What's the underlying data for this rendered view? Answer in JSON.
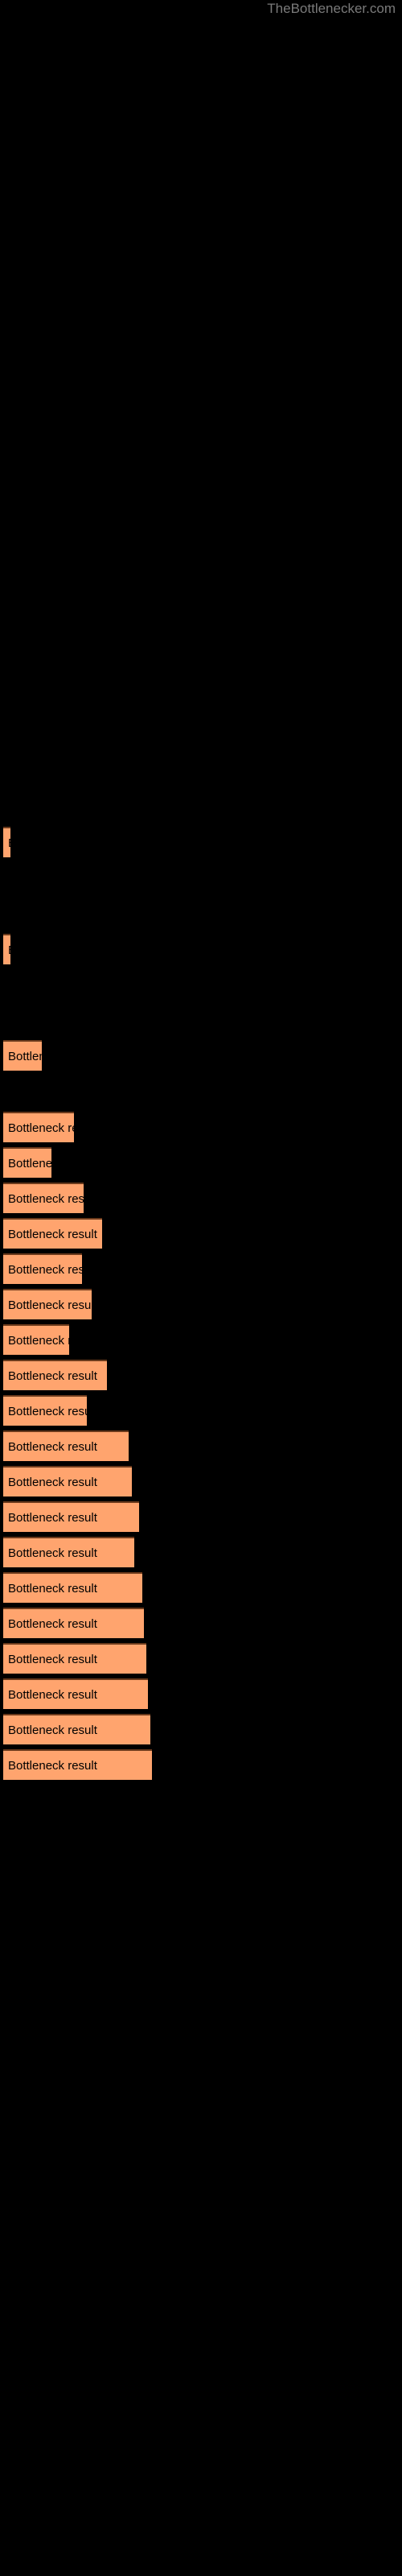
{
  "watermark": "TheBottlenecker.com",
  "colors": {
    "background": "#000000",
    "bar_fill": "#ffa46e",
    "bar_edge": "#6b3a1c",
    "bar_text": "#000000",
    "watermark_text": "#7a7a7a"
  },
  "chart_data": {
    "type": "bar",
    "orientation": "horizontal",
    "title": "",
    "subtitle": "",
    "xlabel": "",
    "ylabel": "",
    "grid": false,
    "legend": null,
    "axis_visible": false,
    "tick_labels_visible": false,
    "bar_label_text": "Bottleneck result",
    "categories": [
      "Bottleneck result",
      "Bottleneck result",
      "Bottleneck result",
      "Bottleneck result",
      "Bottleneck result",
      "Bottleneck result",
      "Bottleneck result",
      "Bottleneck result",
      "Bottleneck result",
      "Bottleneck result",
      "Bottleneck result",
      "Bottleneck result",
      "Bottleneck result",
      "Bottleneck result",
      "Bottleneck result",
      "Bottleneck result",
      "Bottleneck result",
      "Bottleneck result",
      "Bottleneck result",
      "Bottleneck result",
      "Bottleneck result",
      "Bottleneck result"
    ],
    "values": [
      9,
      9,
      25,
      45,
      27,
      57,
      72,
      46,
      67,
      38,
      83,
      50,
      101,
      105,
      118,
      110,
      130,
      133,
      146,
      148,
      157,
      160
    ],
    "xlim": [
      0,
      500
    ],
    "bar_tops": [
      1027,
      1203,
      1291,
      1335,
      1379,
      1423,
      1467,
      1511,
      1555,
      1599,
      1643,
      1687,
      1731,
      1775,
      1819,
      1863,
      1907,
      1951,
      1995,
      2039,
      2083,
      2127
    ]
  },
  "bars": [
    {
      "width": 9,
      "top": 1027,
      "label": "Bottleneck result"
    },
    {
      "width": 9,
      "top": 1160,
      "label": "Bottleneck result"
    },
    {
      "width": 48,
      "top": 1292,
      "label": "Bottleneck result"
    },
    {
      "width": 88,
      "top": 1381,
      "label": "Bottleneck result"
    },
    {
      "width": 60,
      "top": 1425,
      "label": "Bottleneck result"
    },
    {
      "width": 100,
      "top": 1469,
      "label": "Bottleneck result"
    },
    {
      "width": 123,
      "top": 1513,
      "label": "Bottleneck result"
    },
    {
      "width": 98,
      "top": 1557,
      "label": "Bottleneck result"
    },
    {
      "width": 110,
      "top": 1601,
      "label": "Bottleneck result"
    },
    {
      "width": 82,
      "top": 1645,
      "label": "Bottleneck result"
    },
    {
      "width": 129,
      "top": 1689,
      "label": "Bottleneck result"
    },
    {
      "width": 104,
      "top": 1733,
      "label": "Bottleneck result"
    },
    {
      "width": 156,
      "top": 1777,
      "label": "Bottleneck result"
    },
    {
      "width": 160,
      "top": 1821,
      "label": "Bottleneck result"
    },
    {
      "width": 169,
      "top": 1865,
      "label": "Bottleneck result"
    },
    {
      "width": 163,
      "top": 1909,
      "label": "Bottleneck result"
    },
    {
      "width": 173,
      "top": 1953,
      "label": "Bottleneck result"
    },
    {
      "width": 175,
      "top": 1997,
      "label": "Bottleneck result"
    },
    {
      "width": 178,
      "top": 2041,
      "label": "Bottleneck result"
    },
    {
      "width": 180,
      "top": 2085,
      "label": "Bottleneck result"
    },
    {
      "width": 183,
      "top": 2129,
      "label": "Bottleneck result"
    },
    {
      "width": 185,
      "top": 2173,
      "label": "Bottleneck result"
    }
  ]
}
